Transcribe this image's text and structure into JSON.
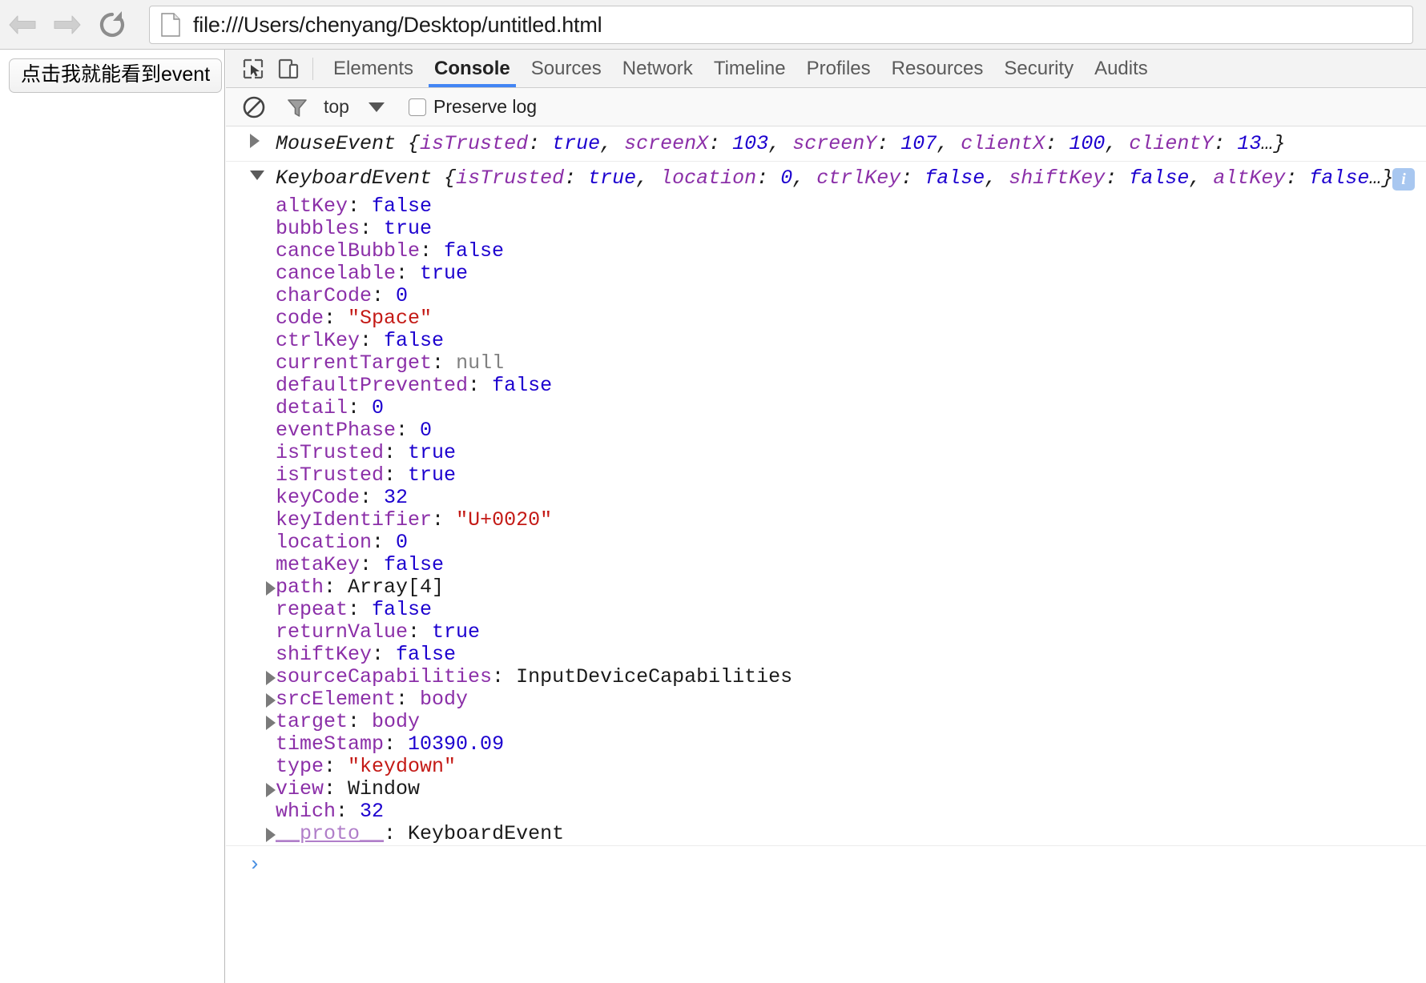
{
  "browser": {
    "back_label": "Back",
    "forward_label": "Forward",
    "reload_label": "Reload",
    "page_icon": "document-icon",
    "url": "file:///Users/chenyang/Desktop/untitled.html"
  },
  "page": {
    "button_label": "点击我就能看到event"
  },
  "devtools": {
    "inspect_icon": "inspect-element-icon",
    "device_icon": "device-toolbar-icon",
    "tabs": [
      {
        "label": "Elements",
        "selected": false
      },
      {
        "label": "Console",
        "selected": true
      },
      {
        "label": "Sources",
        "selected": false
      },
      {
        "label": "Network",
        "selected": false
      },
      {
        "label": "Timeline",
        "selected": false
      },
      {
        "label": "Profiles",
        "selected": false
      },
      {
        "label": "Resources",
        "selected": false
      },
      {
        "label": "Security",
        "selected": false
      },
      {
        "label": "Audits",
        "selected": false
      }
    ],
    "filterbar": {
      "clear_icon": "clear-console-icon",
      "filter_icon": "filter-funnel-icon",
      "context": "top",
      "context_caret": "chevron-down-icon",
      "preserve_log_label": "Preserve log",
      "preserve_log_checked": false
    },
    "console": {
      "messages": [
        {
          "disclosure": "collapsed",
          "ctor": "MouseEvent",
          "open_brace": " {",
          "preview": [
            {
              "name": "isTrusted",
              "value": "true",
              "kind": "bool"
            },
            {
              "name": "screenX",
              "value": "103",
              "kind": "num"
            },
            {
              "name": "screenY",
              "value": "107",
              "kind": "num"
            },
            {
              "name": "clientX",
              "value": "100",
              "kind": "num"
            },
            {
              "name": "clientY",
              "value": "13",
              "kind": "num"
            }
          ],
          "tail": "…}",
          "badge": null
        },
        {
          "disclosure": "expanded",
          "ctor": "KeyboardEvent",
          "open_brace": " {",
          "preview": [
            {
              "name": "isTrusted",
              "value": "true",
              "kind": "bool"
            },
            {
              "name": "location",
              "value": "0",
              "kind": "num"
            },
            {
              "name": "ctrlKey",
              "value": "false",
              "kind": "bool"
            },
            {
              "name": "shiftKey",
              "value": "false",
              "kind": "bool"
            },
            {
              "name": "altKey",
              "value": "false",
              "kind": "bool"
            }
          ],
          "tail": "…}",
          "badge": "i"
        }
      ],
      "properties": [
        {
          "disclosure": null,
          "name": "altKey",
          "value": "false",
          "kind": "bool"
        },
        {
          "disclosure": null,
          "name": "bubbles",
          "value": "true",
          "kind": "bool"
        },
        {
          "disclosure": null,
          "name": "cancelBubble",
          "value": "false",
          "kind": "bool"
        },
        {
          "disclosure": null,
          "name": "cancelable",
          "value": "true",
          "kind": "bool"
        },
        {
          "disclosure": null,
          "name": "charCode",
          "value": "0",
          "kind": "num"
        },
        {
          "disclosure": null,
          "name": "code",
          "value": "\"Space\"",
          "kind": "str"
        },
        {
          "disclosure": null,
          "name": "ctrlKey",
          "value": "false",
          "kind": "bool"
        },
        {
          "disclosure": null,
          "name": "currentTarget",
          "value": "null",
          "kind": "null"
        },
        {
          "disclosure": null,
          "name": "defaultPrevented",
          "value": "false",
          "kind": "bool"
        },
        {
          "disclosure": null,
          "name": "detail",
          "value": "0",
          "kind": "num"
        },
        {
          "disclosure": null,
          "name": "eventPhase",
          "value": "0",
          "kind": "num"
        },
        {
          "disclosure": null,
          "name": "isTrusted",
          "value": "true",
          "kind": "bool"
        },
        {
          "disclosure": null,
          "name": "isTrusted",
          "value": "true",
          "kind": "bool"
        },
        {
          "disclosure": null,
          "name": "keyCode",
          "value": "32",
          "kind": "num"
        },
        {
          "disclosure": null,
          "name": "keyIdentifier",
          "value": "\"U+0020\"",
          "kind": "str"
        },
        {
          "disclosure": null,
          "name": "location",
          "value": "0",
          "kind": "num"
        },
        {
          "disclosure": null,
          "name": "metaKey",
          "value": "false",
          "kind": "bool"
        },
        {
          "disclosure": "collapsed",
          "name": "path",
          "value": "Array[4]",
          "kind": "plain"
        },
        {
          "disclosure": null,
          "name": "repeat",
          "value": "false",
          "kind": "bool"
        },
        {
          "disclosure": null,
          "name": "returnValue",
          "value": "true",
          "kind": "bool"
        },
        {
          "disclosure": null,
          "name": "shiftKey",
          "value": "false",
          "kind": "bool"
        },
        {
          "disclosure": "collapsed",
          "name": "sourceCapabilities",
          "value": "InputDeviceCapabilities",
          "kind": "plain"
        },
        {
          "disclosure": "collapsed",
          "name": "srcElement",
          "value": "body",
          "kind": "node"
        },
        {
          "disclosure": "collapsed",
          "name": "target",
          "value": "body",
          "kind": "node"
        },
        {
          "disclosure": null,
          "name": "timeStamp",
          "value": "10390.09",
          "kind": "num"
        },
        {
          "disclosure": null,
          "name": "type",
          "value": "\"keydown\"",
          "kind": "str"
        },
        {
          "disclosure": "collapsed",
          "name": "view",
          "value": "Window",
          "kind": "plain"
        },
        {
          "disclosure": null,
          "name": "which",
          "value": "32",
          "kind": "num"
        },
        {
          "disclosure": "collapsed",
          "name": "__proto__",
          "value": "KeyboardEvent",
          "kind": "plain",
          "proto": true
        }
      ],
      "prompt_caret": "›"
    }
  },
  "colors": {
    "accent": "#4285f4",
    "property_name": "#8b2fa8",
    "value_number": "#1c00cf",
    "value_string": "#c41a16",
    "value_null": "#808080",
    "badge_bg": "#a8c7f0"
  }
}
